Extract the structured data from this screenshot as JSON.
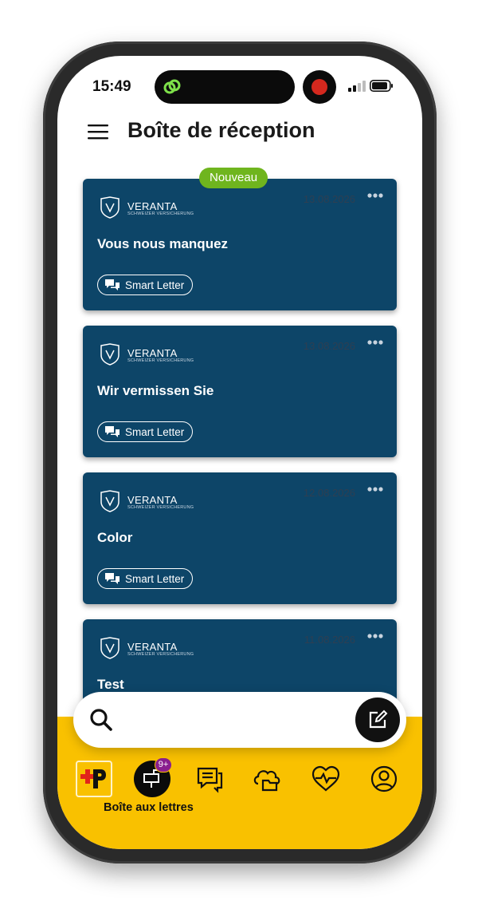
{
  "status_bar": {
    "time": "15:49"
  },
  "header": {
    "title": "Boîte de réception"
  },
  "cards": [
    {
      "badge": "Nouveau",
      "brand": "VERANTA",
      "brand_sub": "SCHWEIZER VERSICHERUNG",
      "date": "13.08.2026",
      "subject": "Vous nous manquez",
      "tag": "Smart Letter"
    },
    {
      "badge": "",
      "brand": "VERANTA",
      "brand_sub": "SCHWEIZER VERSICHERUNG",
      "date": "13.08.2026",
      "subject": "Wir vermissen Sie",
      "tag": "Smart Letter"
    },
    {
      "badge": "",
      "brand": "VERANTA",
      "brand_sub": "SCHWEIZER VERSICHERUNG",
      "date": "12.08.2026",
      "subject": "Color",
      "tag": "Smart Letter"
    },
    {
      "badge": "",
      "brand": "VERANTA",
      "brand_sub": "SCHWEIZER VERSICHERUNG",
      "date": "11.08.2026",
      "subject": "Test",
      "tag": ""
    }
  ],
  "bottom_nav": {
    "badge": "9+",
    "active_label": "Boîte aux lettres",
    "items": [
      "post-logo",
      "mailbox",
      "letters",
      "cloud-folder",
      "health",
      "profile"
    ]
  },
  "colors": {
    "card_bg": "#0d4568",
    "badge_new": "#6fb51e",
    "nav_bg": "#f9c100",
    "notification_badge": "#8a1f8f",
    "post_red": "#e2231a"
  },
  "icons": [
    "menu-icon",
    "search-icon",
    "compose-icon",
    "shield-logo-icon",
    "more-icon",
    "chat-bubbles-icon"
  ]
}
